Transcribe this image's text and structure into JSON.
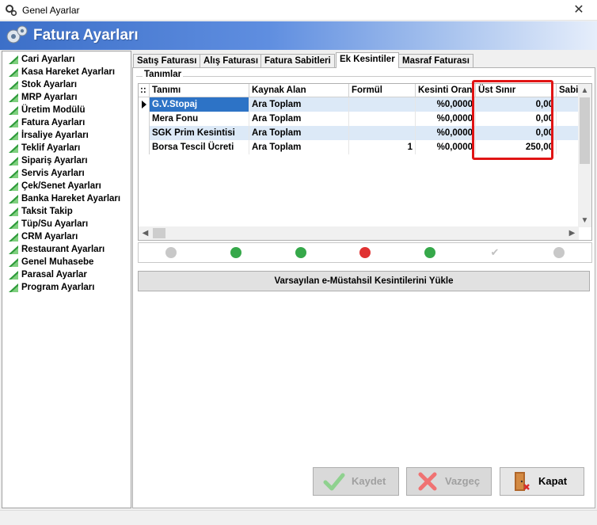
{
  "window": {
    "title": "Genel Ayarlar",
    "close_glyph": "✕"
  },
  "banner": {
    "title": "Fatura Ayarları"
  },
  "sidebar": {
    "items": [
      {
        "label": "Cari Ayarları"
      },
      {
        "label": "Kasa Hareket Ayarları"
      },
      {
        "label": "Stok Ayarları"
      },
      {
        "label": "MRP Ayarları"
      },
      {
        "label": "Üretim Modülü"
      },
      {
        "label": "Fatura Ayarları"
      },
      {
        "label": "İrsaliye Ayarları"
      },
      {
        "label": "Teklif Ayarları"
      },
      {
        "label": "Sipariş Ayarları"
      },
      {
        "label": "Servis Ayarları"
      },
      {
        "label": "Çek/Senet Ayarları"
      },
      {
        "label": "Banka Hareket Ayarları"
      },
      {
        "label": "Taksit Takip"
      },
      {
        "label": "Tüp/Su Ayarları"
      },
      {
        "label": "CRM Ayarları"
      },
      {
        "label": "Restaurant Ayarları"
      },
      {
        "label": "Genel Muhasebe"
      },
      {
        "label": "Parasal Ayarlar"
      },
      {
        "label": "Program Ayarları"
      }
    ]
  },
  "tabs": [
    {
      "label": "Satış Faturası"
    },
    {
      "label": "Alış Faturası"
    },
    {
      "label": "Fatura Sabitleri"
    },
    {
      "label": "Ek Kesintiler",
      "active": true
    },
    {
      "label": "Masraf Faturası"
    }
  ],
  "group": {
    "label": "Tanımlar"
  },
  "grid": {
    "indicator_header": "::",
    "columns": [
      "Tanımı",
      "Kaynak Alan",
      "Formül",
      "Kesinti Oranı",
      "Üst Sınır",
      "Sabit"
    ],
    "rows": [
      [
        "G.V.Stopaj",
        "Ara Toplam",
        "",
        "%0,0000",
        "0,00"
      ],
      [
        "Mera Fonu",
        "Ara Toplam",
        "",
        "%0,0000",
        "0,00"
      ],
      [
        "SGK Prim Kesintisi",
        "Ara Toplam",
        "",
        "%0,0000",
        "0,00"
      ],
      [
        "Borsa Tescil Ücreti",
        "Ara Toplam",
        "1",
        "%0,0000",
        "250,00"
      ]
    ],
    "selected_row": 0
  },
  "navigator": {
    "buttons": [
      "first-icon",
      "prior-icon",
      "insert-icon",
      "delete-icon",
      "edit-icon",
      "post-icon",
      "cancel-icon"
    ]
  },
  "load_button": {
    "label": "Varsayılan e-Müstahsil Kesintilerini Yükle"
  },
  "actions": {
    "save": {
      "label": "Kaydet",
      "disabled": true
    },
    "cancel": {
      "label": "Vazgeç",
      "disabled": true
    },
    "close": {
      "label": "Kapat",
      "disabled": false
    }
  },
  "colors": {
    "selection": "#2d73c6",
    "alt_row": "#dce9f7",
    "highlight": "#e01414",
    "banner_start": "#3c6fc8"
  }
}
